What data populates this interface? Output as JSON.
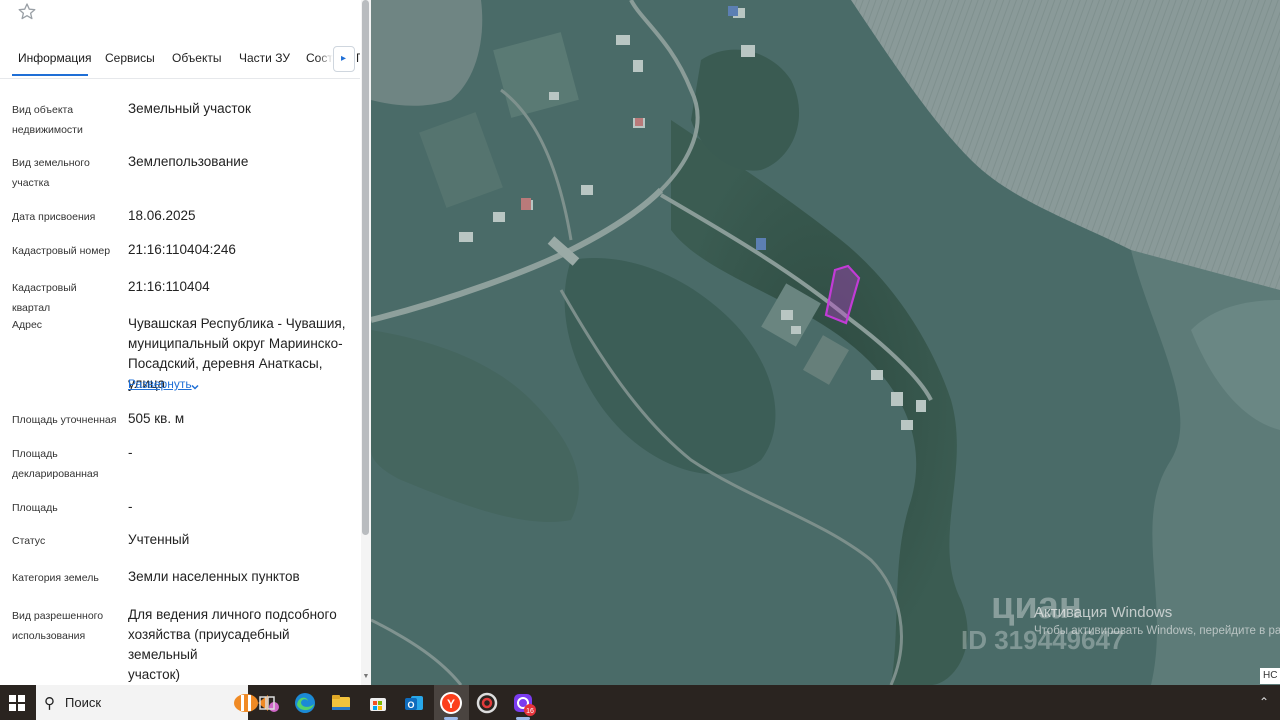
{
  "panel": {
    "favorite_icon": "star-outline-icon",
    "tabs": [
      {
        "label": "Информация",
        "active": true
      },
      {
        "label": "Сервисы"
      },
      {
        "label": "Объекты"
      },
      {
        "label": "Части ЗУ"
      },
      {
        "label": "Соста"
      },
      {
        "label": "Г"
      }
    ],
    "tab_scroll_icon": "chevron-right-icon",
    "rows": [
      {
        "label_lines": [
          "Вид объекта",
          "недвижимости"
        ],
        "value_lines": [
          "Земельный участок"
        ]
      },
      {
        "label_lines": [
          "Вид земельного",
          "участка"
        ],
        "value_lines": [
          "Землепользование"
        ]
      },
      {
        "label_lines": [
          "Дата присвоения"
        ],
        "value_lines": [
          "18.06.2025"
        ]
      },
      {
        "label_lines": [
          "Кадастровый номер"
        ],
        "value_lines": [
          "21:16:110404:246"
        ]
      },
      {
        "label_lines": [
          "Кадастровый квартал"
        ],
        "value_lines": [
          "21:16:110404"
        ]
      },
      {
        "label_lines": [
          "Адрес"
        ],
        "value_lines": [
          "Чувашская Республика - Чувашия,",
          "муниципальный округ Мариинско-",
          "Посадский, деревня Анаткасы, улица"
        ]
      },
      {
        "label_lines": [
          "Площадь уточненная"
        ],
        "value_lines": [
          "505 кв. м"
        ]
      },
      {
        "label_lines": [
          "Площадь",
          "декларированная"
        ],
        "value_lines": [
          "-"
        ]
      },
      {
        "label_lines": [
          "Площадь"
        ],
        "value_lines": [
          "-"
        ]
      },
      {
        "label_lines": [
          "Статус"
        ],
        "value_lines": [
          "Учтенный"
        ]
      },
      {
        "label_lines": [
          "Категория земель"
        ],
        "value_lines": [
          "Земли населенных пунктов"
        ]
      },
      {
        "label_lines": [
          "Вид разрешенного",
          "использования"
        ],
        "value_lines": [
          "Для ведения личного подсобного",
          "хозяйства (приусадебный земельный",
          "участок)"
        ]
      }
    ],
    "expand_label": "Развернуть",
    "expand_icon": "chevron-down-icon"
  },
  "map": {
    "parcel_color": "#c23bd6",
    "watermark_logo": "циан",
    "watermark_id": "ID 319449647",
    "windows_activation_title": "Активация Windows",
    "windows_activation_text": "Чтобы активировать Windows, перейдите в раз",
    "corner_badge": "НС"
  },
  "taskbar": {
    "start_icon": "windows-logo-icon",
    "search_icon": "search-icon",
    "search_placeholder": "Поиск",
    "apps": [
      {
        "name": "task-view-icon"
      },
      {
        "name": "edge-icon"
      },
      {
        "name": "file-explorer-icon"
      },
      {
        "name": "microsoft-store-icon"
      },
      {
        "name": "outlook-icon"
      },
      {
        "name": "yandex-browser-icon",
        "active": true
      },
      {
        "name": "ccleaner-icon"
      },
      {
        "name": "app-with-badge-icon",
        "badge": "16"
      }
    ],
    "tray_icon": "chevron-up-icon"
  }
}
